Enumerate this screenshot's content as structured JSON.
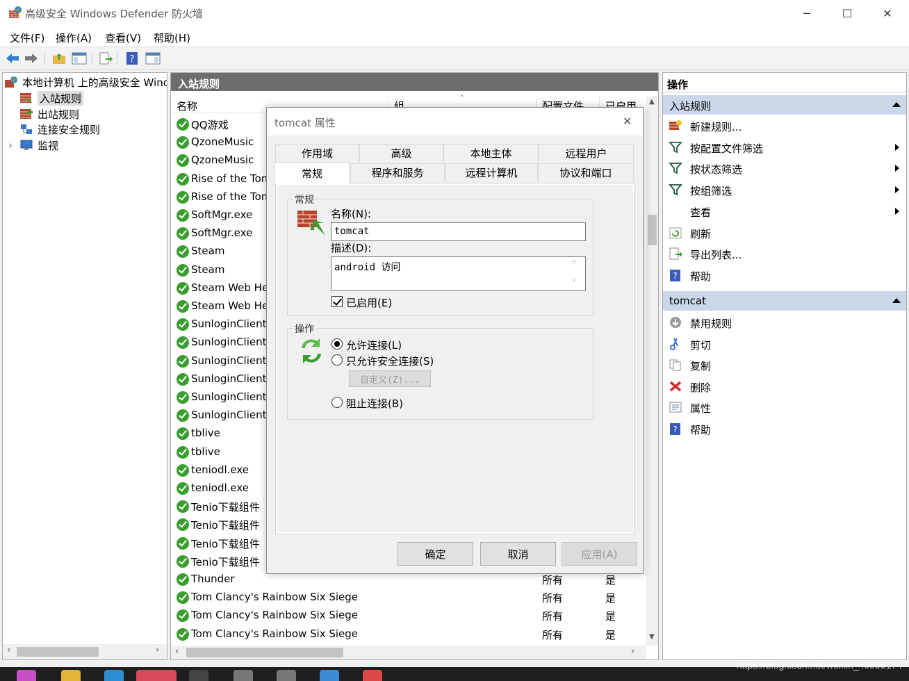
{
  "window": {
    "title": "高级安全 Windows Defender 防火墙",
    "minimize_glyph": "─",
    "maximize_glyph": "☐",
    "close_glyph": "✕"
  },
  "menubar": [
    "文件(F)",
    "操作(A)",
    "查看(V)",
    "帮助(H)"
  ],
  "toolbar": {
    "icons": [
      "back-arrow-icon",
      "forward-arrow-icon",
      "up-folder-icon",
      "show-hide-console-tree-icon",
      "export-list-icon",
      "help-icon",
      "show-hide-action-pane-icon"
    ]
  },
  "tree": {
    "root": "本地计算机 上的高级安全 Windows Defender 防火墙",
    "items": [
      "入站规则",
      "出站规则",
      "连接安全规则",
      "监视"
    ],
    "expander": "›"
  },
  "center": {
    "header": "入站规则",
    "columns": [
      "名称",
      "组",
      "配置文件",
      "已启用"
    ],
    "sort_glyph": "˄",
    "rows": [
      {
        "name": "QQ游戏",
        "profile": "",
        "enabled": ""
      },
      {
        "name": "QzoneMusic",
        "profile": "",
        "enabled": ""
      },
      {
        "name": "QzoneMusic",
        "profile": "",
        "enabled": ""
      },
      {
        "name": "Rise of the Tomb Raider",
        "profile": "",
        "enabled": ""
      },
      {
        "name": "Rise of the Tomb Raider",
        "profile": "",
        "enabled": ""
      },
      {
        "name": "SoftMgr.exe",
        "profile": "",
        "enabled": ""
      },
      {
        "name": "SoftMgr.exe",
        "profile": "",
        "enabled": ""
      },
      {
        "name": "Steam",
        "profile": "",
        "enabled": ""
      },
      {
        "name": "Steam",
        "profile": "",
        "enabled": ""
      },
      {
        "name": "Steam Web Helper",
        "profile": "",
        "enabled": ""
      },
      {
        "name": "Steam Web Helper",
        "profile": "",
        "enabled": ""
      },
      {
        "name": "SunloginClient",
        "profile": "",
        "enabled": ""
      },
      {
        "name": "SunloginClient",
        "profile": "",
        "enabled": ""
      },
      {
        "name": "SunloginClient",
        "profile": "",
        "enabled": ""
      },
      {
        "name": "SunloginClient",
        "profile": "",
        "enabled": ""
      },
      {
        "name": "SunloginClient",
        "profile": "",
        "enabled": ""
      },
      {
        "name": "SunloginClient",
        "profile": "",
        "enabled": ""
      },
      {
        "name": "tblive",
        "profile": "",
        "enabled": ""
      },
      {
        "name": "tblive",
        "profile": "",
        "enabled": ""
      },
      {
        "name": "teniodl.exe",
        "profile": "",
        "enabled": ""
      },
      {
        "name": "teniodl.exe",
        "profile": "",
        "enabled": ""
      },
      {
        "name": "Tenio下载组件",
        "profile": "",
        "enabled": ""
      },
      {
        "name": "Tenio下载组件",
        "profile": "",
        "enabled": ""
      },
      {
        "name": "Tenio下载组件",
        "profile": "",
        "enabled": ""
      },
      {
        "name": "Tenio下载组件",
        "profile": "",
        "enabled": ""
      },
      {
        "name": "Thunder",
        "profile": "所有",
        "enabled": "是"
      },
      {
        "name": "Tom Clancy's Rainbow Six Siege",
        "profile": "所有",
        "enabled": "是"
      },
      {
        "name": "Tom Clancy's Rainbow Six Siege",
        "profile": "所有",
        "enabled": "是"
      },
      {
        "name": "Tom Clancy's Rainbow Six Siege",
        "profile": "所有",
        "enabled": "是"
      }
    ]
  },
  "actions": {
    "title": "操作",
    "section1": {
      "title": "入站规则",
      "items": [
        {
          "label": "新建规则...",
          "icon": "new-rule-icon",
          "submenu": false
        },
        {
          "label": "按配置文件筛选",
          "icon": "filter-icon",
          "submenu": true
        },
        {
          "label": "按状态筛选",
          "icon": "filter-icon",
          "submenu": true
        },
        {
          "label": "按组筛选",
          "icon": "filter-icon",
          "submenu": true
        },
        {
          "label": "查看",
          "icon": "",
          "submenu": true
        },
        {
          "label": "刷新",
          "icon": "refresh-icon",
          "submenu": false
        },
        {
          "label": "导出列表...",
          "icon": "export-list-icon",
          "submenu": false
        },
        {
          "label": "帮助",
          "icon": "help-icon",
          "submenu": false
        }
      ]
    },
    "section2": {
      "title": "tomcat",
      "items": [
        {
          "label": "禁用规则",
          "icon": "disable-rule-icon"
        },
        {
          "label": "剪切",
          "icon": "cut-icon"
        },
        {
          "label": "复制",
          "icon": "copy-icon"
        },
        {
          "label": "删除",
          "icon": "delete-icon"
        },
        {
          "label": "属性",
          "icon": "properties-icon"
        },
        {
          "label": "帮助",
          "icon": "help-icon"
        }
      ]
    }
  },
  "dialog": {
    "title": "tomcat 属性",
    "close_glyph": "✕",
    "tabs_row1": [
      "作用域",
      "高级",
      "本地主体",
      "远程用户"
    ],
    "tabs_row2": [
      "常规",
      "程序和服务",
      "远程计算机",
      "协议和端口"
    ],
    "general": {
      "group_label": "常规",
      "name_label": "名称(N):",
      "name_value": "tomcat",
      "desc_label": "描述(D):",
      "desc_value": "android 访问",
      "enabled_label": "已启用(E)",
      "enabled": true
    },
    "action": {
      "group_label": "操作",
      "options": [
        "允许连接(L)",
        "只允许安全连接(S)",
        "阻止连接(B)"
      ],
      "selected": "允许连接(L)",
      "customize": "自定义(Z)..."
    },
    "buttons": {
      "ok": "确定",
      "cancel": "取消",
      "apply": "应用(A)"
    }
  },
  "watermark": "https://blog.csdn.net/weixin_40999174",
  "colors": {
    "section_header": "#c9d7e8",
    "center_header": "#6d6d6d",
    "check_green": "#3a9e2f"
  }
}
